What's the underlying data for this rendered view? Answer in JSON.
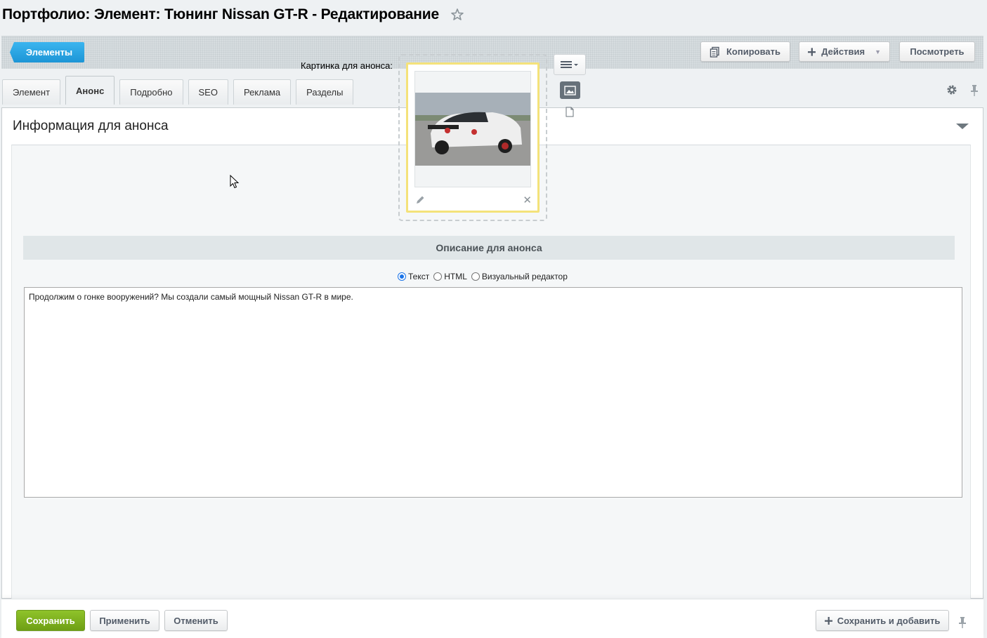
{
  "page": {
    "title": "Портфолио: Элемент: Тюнинг Nissan GT-R - Редактирование",
    "favorite_icon": "star-icon"
  },
  "toolbar": {
    "elements_label": "Элементы",
    "copy_label": "Копировать",
    "actions_label": "Действия",
    "view_label": "Посмотреть"
  },
  "tabs": [
    {
      "label": "Элемент",
      "active": false
    },
    {
      "label": "Анонс",
      "active": true
    },
    {
      "label": "Подробно",
      "active": false
    },
    {
      "label": "SEO",
      "active": false
    },
    {
      "label": "Реклама",
      "active": false
    },
    {
      "label": "Разделы",
      "active": false
    }
  ],
  "section": {
    "title": "Информация для анонса",
    "picture_label": "Картинка для анонса:",
    "description_title": "Описание для анонса",
    "editor_modes": [
      {
        "label": "Текст",
        "selected": true
      },
      {
        "label": "HTML",
        "selected": false
      },
      {
        "label": "Визуальный редактор",
        "selected": false
      }
    ],
    "description_text": "Продолжим о гонке вооружений? Мы создали самый мощный Nissan GT-R в мире."
  },
  "footer": {
    "save_label": "Сохранить",
    "apply_label": "Применить",
    "cancel_label": "Отменить",
    "save_add_label": "Сохранить и добавить"
  },
  "colors": {
    "accent_blue": "#1c95d6",
    "save_green": "#7cb01f",
    "frame_yellow": "#f4e27a"
  }
}
